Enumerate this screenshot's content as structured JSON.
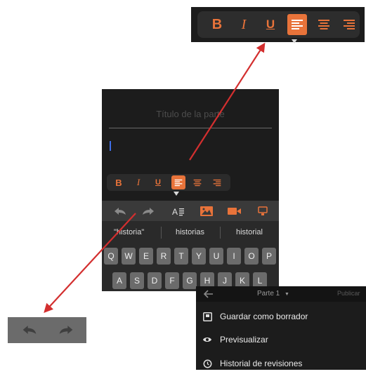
{
  "format_toolbar": {
    "bold": "B",
    "italic": "I",
    "underline": "U",
    "active_button": "align-left",
    "icons": [
      "align-left-icon",
      "align-center-icon",
      "align-right-icon"
    ],
    "accent_color": "#e8733a"
  },
  "editor": {
    "title_placeholder": "Título de la parte",
    "body_value": ""
  },
  "editor_toolbar": {
    "icons": [
      "undo-icon",
      "redo-icon",
      "text-format-icon",
      "image-icon",
      "video-icon",
      "more-icon"
    ]
  },
  "keyboard": {
    "suggestions": [
      "\"historia\"",
      "historias",
      "historial"
    ],
    "row1": [
      "Q",
      "W",
      "E",
      "R",
      "T",
      "Y",
      "U",
      "I",
      "O",
      "P"
    ],
    "row2": [
      "A",
      "S",
      "D",
      "F",
      "G",
      "H",
      "J",
      "K",
      "L"
    ]
  },
  "menu": {
    "part_label": "Parte 1",
    "publish_label": "Publicar",
    "items": [
      {
        "label": "Guardar como borrador",
        "icon": "save-draft-icon"
      },
      {
        "label": "Previsualizar",
        "icon": "eye-icon"
      },
      {
        "label": "Historial de revisiones",
        "icon": "history-icon"
      }
    ]
  }
}
